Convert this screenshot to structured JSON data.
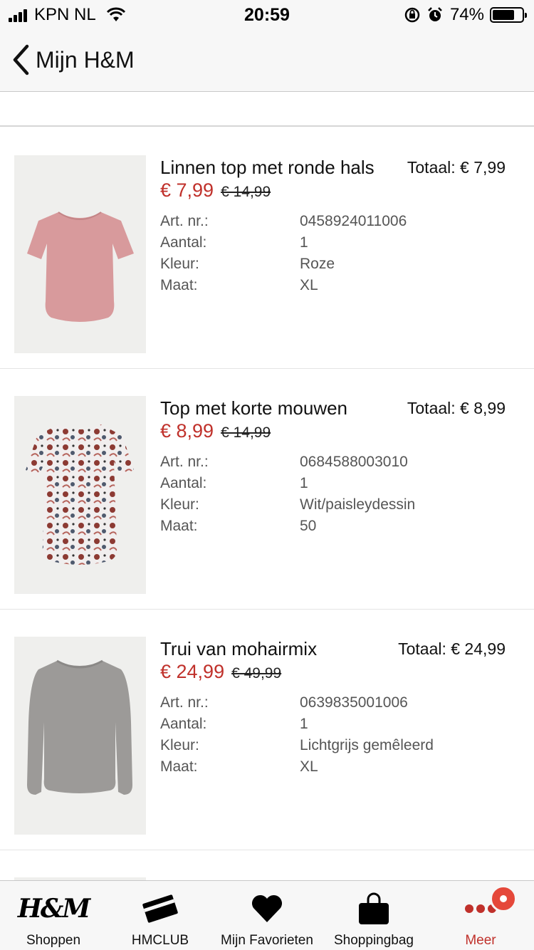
{
  "status_bar": {
    "carrier": "KPN NL",
    "time": "20:59",
    "battery": "74%",
    "battery_level": 0.74
  },
  "nav": {
    "back_label": "Mijn H&M"
  },
  "labels": {
    "article": "Art. nr.:",
    "quantity": "Aantal:",
    "color": "Kleur:",
    "size": "Maat:"
  },
  "products": [
    {
      "name": "Linnen top met ronde hals",
      "total": "Totaal: € 7,99",
      "price": "€ 7,99",
      "old_price": "€ 14,99",
      "article": "0458924011006",
      "quantity": "1",
      "color": "Roze",
      "size": "XL",
      "image": "pink-tshirt"
    },
    {
      "name": "Top met korte mouwen",
      "total": "Totaal: € 8,99",
      "price": "€ 8,99",
      "old_price": "€ 14,99",
      "article": "0684588003010",
      "quantity": "1",
      "color": "Wit/paisleydessin",
      "size": "50",
      "image": "paisley-top"
    },
    {
      "name": "Trui van mohairmix",
      "total": "Totaal: € 24,99",
      "price": "€ 24,99",
      "old_price": "€ 49,99",
      "article": "0639835001006",
      "quantity": "1",
      "color": "Lichtgrijs gemêleerd",
      "size": "XL",
      "image": "grey-sweater"
    }
  ],
  "tabs": [
    {
      "label": "Shoppen",
      "icon": "hm-logo-icon"
    },
    {
      "label": "HMCLUB",
      "icon": "card-icon"
    },
    {
      "label": "Mijn Favorieten",
      "icon": "heart-icon"
    },
    {
      "label": "Shoppingbag",
      "icon": "bag-icon"
    },
    {
      "label": "Meer",
      "icon": "more-dots-icon",
      "active": true
    }
  ],
  "logo_text": "H&M",
  "colors": {
    "sale_red": "#c0312b",
    "badge": "#e5483a",
    "bar_bg": "#f7f7f7"
  }
}
